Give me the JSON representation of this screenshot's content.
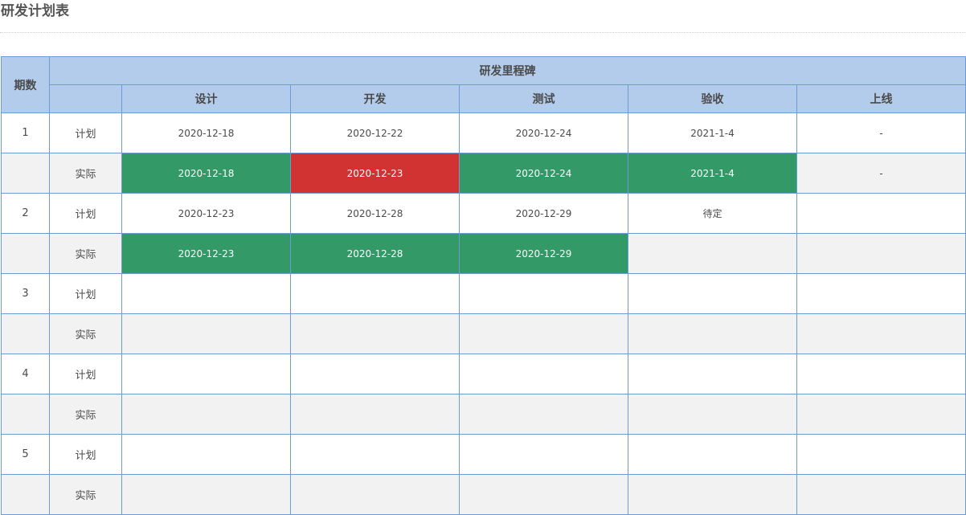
{
  "title": "研发计划表",
  "colors": {
    "header_bg": "#b4cceb",
    "border": "#6f9ad3",
    "on_time": "#339966",
    "late": "#d13232",
    "actual_row_bg": "#f2f2f2"
  },
  "table": {
    "period_header": "期数",
    "milestone_header": "研发里程碑",
    "milestones": [
      "设计",
      "开发",
      "测试",
      "验收",
      "上线"
    ],
    "periods": [
      {
        "number": "1",
        "plan": {
          "label": "计划",
          "cells": [
            {
              "value": "2020-12-18",
              "status": ""
            },
            {
              "value": "2020-12-22",
              "status": ""
            },
            {
              "value": "2020-12-24",
              "status": ""
            },
            {
              "value": "2021-1-4",
              "status": ""
            },
            {
              "value": "-",
              "status": ""
            }
          ]
        },
        "actual": {
          "label": "实际",
          "cells": [
            {
              "value": "2020-12-18",
              "status": "on_time"
            },
            {
              "value": "2020-12-23",
              "status": "late"
            },
            {
              "value": "2020-12-24",
              "status": "on_time"
            },
            {
              "value": "2021-1-4",
              "status": "on_time"
            },
            {
              "value": "-",
              "status": ""
            }
          ]
        }
      },
      {
        "number": "2",
        "plan": {
          "label": "计划",
          "cells": [
            {
              "value": "2020-12-23",
              "status": ""
            },
            {
              "value": "2020-12-28",
              "status": ""
            },
            {
              "value": "2020-12-29",
              "status": ""
            },
            {
              "value": "待定",
              "status": ""
            },
            {
              "value": "",
              "status": ""
            }
          ]
        },
        "actual": {
          "label": "实际",
          "cells": [
            {
              "value": "2020-12-23",
              "status": "on_time"
            },
            {
              "value": "2020-12-28",
              "status": "on_time"
            },
            {
              "value": "2020-12-29",
              "status": "on_time"
            },
            {
              "value": "",
              "status": ""
            },
            {
              "value": "",
              "status": ""
            }
          ]
        }
      },
      {
        "number": "3",
        "plan": {
          "label": "计划",
          "cells": [
            {
              "value": "",
              "status": ""
            },
            {
              "value": "",
              "status": ""
            },
            {
              "value": "",
              "status": ""
            },
            {
              "value": "",
              "status": ""
            },
            {
              "value": "",
              "status": ""
            }
          ]
        },
        "actual": {
          "label": "实际",
          "cells": [
            {
              "value": "",
              "status": ""
            },
            {
              "value": "",
              "status": ""
            },
            {
              "value": "",
              "status": ""
            },
            {
              "value": "",
              "status": ""
            },
            {
              "value": "",
              "status": ""
            }
          ]
        }
      },
      {
        "number": "4",
        "plan": {
          "label": "计划",
          "cells": [
            {
              "value": "",
              "status": ""
            },
            {
              "value": "",
              "status": ""
            },
            {
              "value": "",
              "status": ""
            },
            {
              "value": "",
              "status": ""
            },
            {
              "value": "",
              "status": ""
            }
          ]
        },
        "actual": {
          "label": "实际",
          "cells": [
            {
              "value": "",
              "status": ""
            },
            {
              "value": "",
              "status": ""
            },
            {
              "value": "",
              "status": ""
            },
            {
              "value": "",
              "status": ""
            },
            {
              "value": "",
              "status": ""
            }
          ]
        }
      },
      {
        "number": "5",
        "plan": {
          "label": "计划",
          "cells": [
            {
              "value": "",
              "status": ""
            },
            {
              "value": "",
              "status": ""
            },
            {
              "value": "",
              "status": ""
            },
            {
              "value": "",
              "status": ""
            },
            {
              "value": "",
              "status": ""
            }
          ]
        },
        "actual": {
          "label": "实际",
          "cells": [
            {
              "value": "",
              "status": ""
            },
            {
              "value": "",
              "status": ""
            },
            {
              "value": "",
              "status": ""
            },
            {
              "value": "",
              "status": ""
            },
            {
              "value": "",
              "status": ""
            }
          ]
        }
      }
    ]
  }
}
